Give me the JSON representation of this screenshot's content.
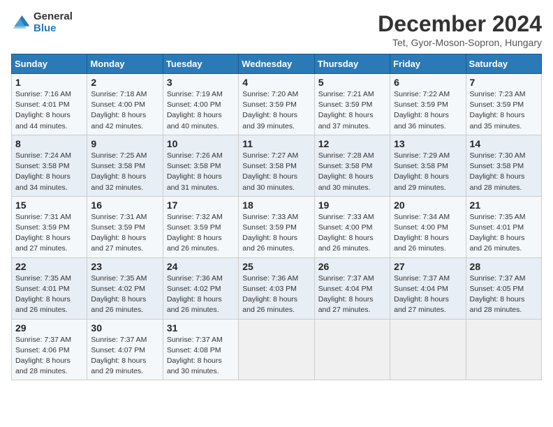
{
  "header": {
    "logo_general": "General",
    "logo_blue": "Blue",
    "month_title": "December 2024",
    "location": "Tet, Gyor-Moson-Sopron, Hungary"
  },
  "days_of_week": [
    "Sunday",
    "Monday",
    "Tuesday",
    "Wednesday",
    "Thursday",
    "Friday",
    "Saturday"
  ],
  "weeks": [
    [
      {
        "day": "1",
        "sunrise": "7:16 AM",
        "sunset": "4:01 PM",
        "daylight": "8 hours and 44 minutes."
      },
      {
        "day": "2",
        "sunrise": "7:18 AM",
        "sunset": "4:00 PM",
        "daylight": "8 hours and 42 minutes."
      },
      {
        "day": "3",
        "sunrise": "7:19 AM",
        "sunset": "4:00 PM",
        "daylight": "8 hours and 40 minutes."
      },
      {
        "day": "4",
        "sunrise": "7:20 AM",
        "sunset": "3:59 PM",
        "daylight": "8 hours and 39 minutes."
      },
      {
        "day": "5",
        "sunrise": "7:21 AM",
        "sunset": "3:59 PM",
        "daylight": "8 hours and 37 minutes."
      },
      {
        "day": "6",
        "sunrise": "7:22 AM",
        "sunset": "3:59 PM",
        "daylight": "8 hours and 36 minutes."
      },
      {
        "day": "7",
        "sunrise": "7:23 AM",
        "sunset": "3:59 PM",
        "daylight": "8 hours and 35 minutes."
      }
    ],
    [
      {
        "day": "8",
        "sunrise": "7:24 AM",
        "sunset": "3:58 PM",
        "daylight": "8 hours and 34 minutes."
      },
      {
        "day": "9",
        "sunrise": "7:25 AM",
        "sunset": "3:58 PM",
        "daylight": "8 hours and 32 minutes."
      },
      {
        "day": "10",
        "sunrise": "7:26 AM",
        "sunset": "3:58 PM",
        "daylight": "8 hours and 31 minutes."
      },
      {
        "day": "11",
        "sunrise": "7:27 AM",
        "sunset": "3:58 PM",
        "daylight": "8 hours and 30 minutes."
      },
      {
        "day": "12",
        "sunrise": "7:28 AM",
        "sunset": "3:58 PM",
        "daylight": "8 hours and 30 minutes."
      },
      {
        "day": "13",
        "sunrise": "7:29 AM",
        "sunset": "3:58 PM",
        "daylight": "8 hours and 29 minutes."
      },
      {
        "day": "14",
        "sunrise": "7:30 AM",
        "sunset": "3:58 PM",
        "daylight": "8 hours and 28 minutes."
      }
    ],
    [
      {
        "day": "15",
        "sunrise": "7:31 AM",
        "sunset": "3:59 PM",
        "daylight": "8 hours and 27 minutes."
      },
      {
        "day": "16",
        "sunrise": "7:31 AM",
        "sunset": "3:59 PM",
        "daylight": "8 hours and 27 minutes."
      },
      {
        "day": "17",
        "sunrise": "7:32 AM",
        "sunset": "3:59 PM",
        "daylight": "8 hours and 26 minutes."
      },
      {
        "day": "18",
        "sunrise": "7:33 AM",
        "sunset": "3:59 PM",
        "daylight": "8 hours and 26 minutes."
      },
      {
        "day": "19",
        "sunrise": "7:33 AM",
        "sunset": "4:00 PM",
        "daylight": "8 hours and 26 minutes."
      },
      {
        "day": "20",
        "sunrise": "7:34 AM",
        "sunset": "4:00 PM",
        "daylight": "8 hours and 26 minutes."
      },
      {
        "day": "21",
        "sunrise": "7:35 AM",
        "sunset": "4:01 PM",
        "daylight": "8 hours and 26 minutes."
      }
    ],
    [
      {
        "day": "22",
        "sunrise": "7:35 AM",
        "sunset": "4:01 PM",
        "daylight": "8 hours and 26 minutes."
      },
      {
        "day": "23",
        "sunrise": "7:35 AM",
        "sunset": "4:02 PM",
        "daylight": "8 hours and 26 minutes."
      },
      {
        "day": "24",
        "sunrise": "7:36 AM",
        "sunset": "4:02 PM",
        "daylight": "8 hours and 26 minutes."
      },
      {
        "day": "25",
        "sunrise": "7:36 AM",
        "sunset": "4:03 PM",
        "daylight": "8 hours and 26 minutes."
      },
      {
        "day": "26",
        "sunrise": "7:37 AM",
        "sunset": "4:04 PM",
        "daylight": "8 hours and 27 minutes."
      },
      {
        "day": "27",
        "sunrise": "7:37 AM",
        "sunset": "4:04 PM",
        "daylight": "8 hours and 27 minutes."
      },
      {
        "day": "28",
        "sunrise": "7:37 AM",
        "sunset": "4:05 PM",
        "daylight": "8 hours and 28 minutes."
      }
    ],
    [
      {
        "day": "29",
        "sunrise": "7:37 AM",
        "sunset": "4:06 PM",
        "daylight": "8 hours and 28 minutes."
      },
      {
        "day": "30",
        "sunrise": "7:37 AM",
        "sunset": "4:07 PM",
        "daylight": "8 hours and 29 minutes."
      },
      {
        "day": "31",
        "sunrise": "7:37 AM",
        "sunset": "4:08 PM",
        "daylight": "8 hours and 30 minutes."
      },
      null,
      null,
      null,
      null
    ]
  ]
}
